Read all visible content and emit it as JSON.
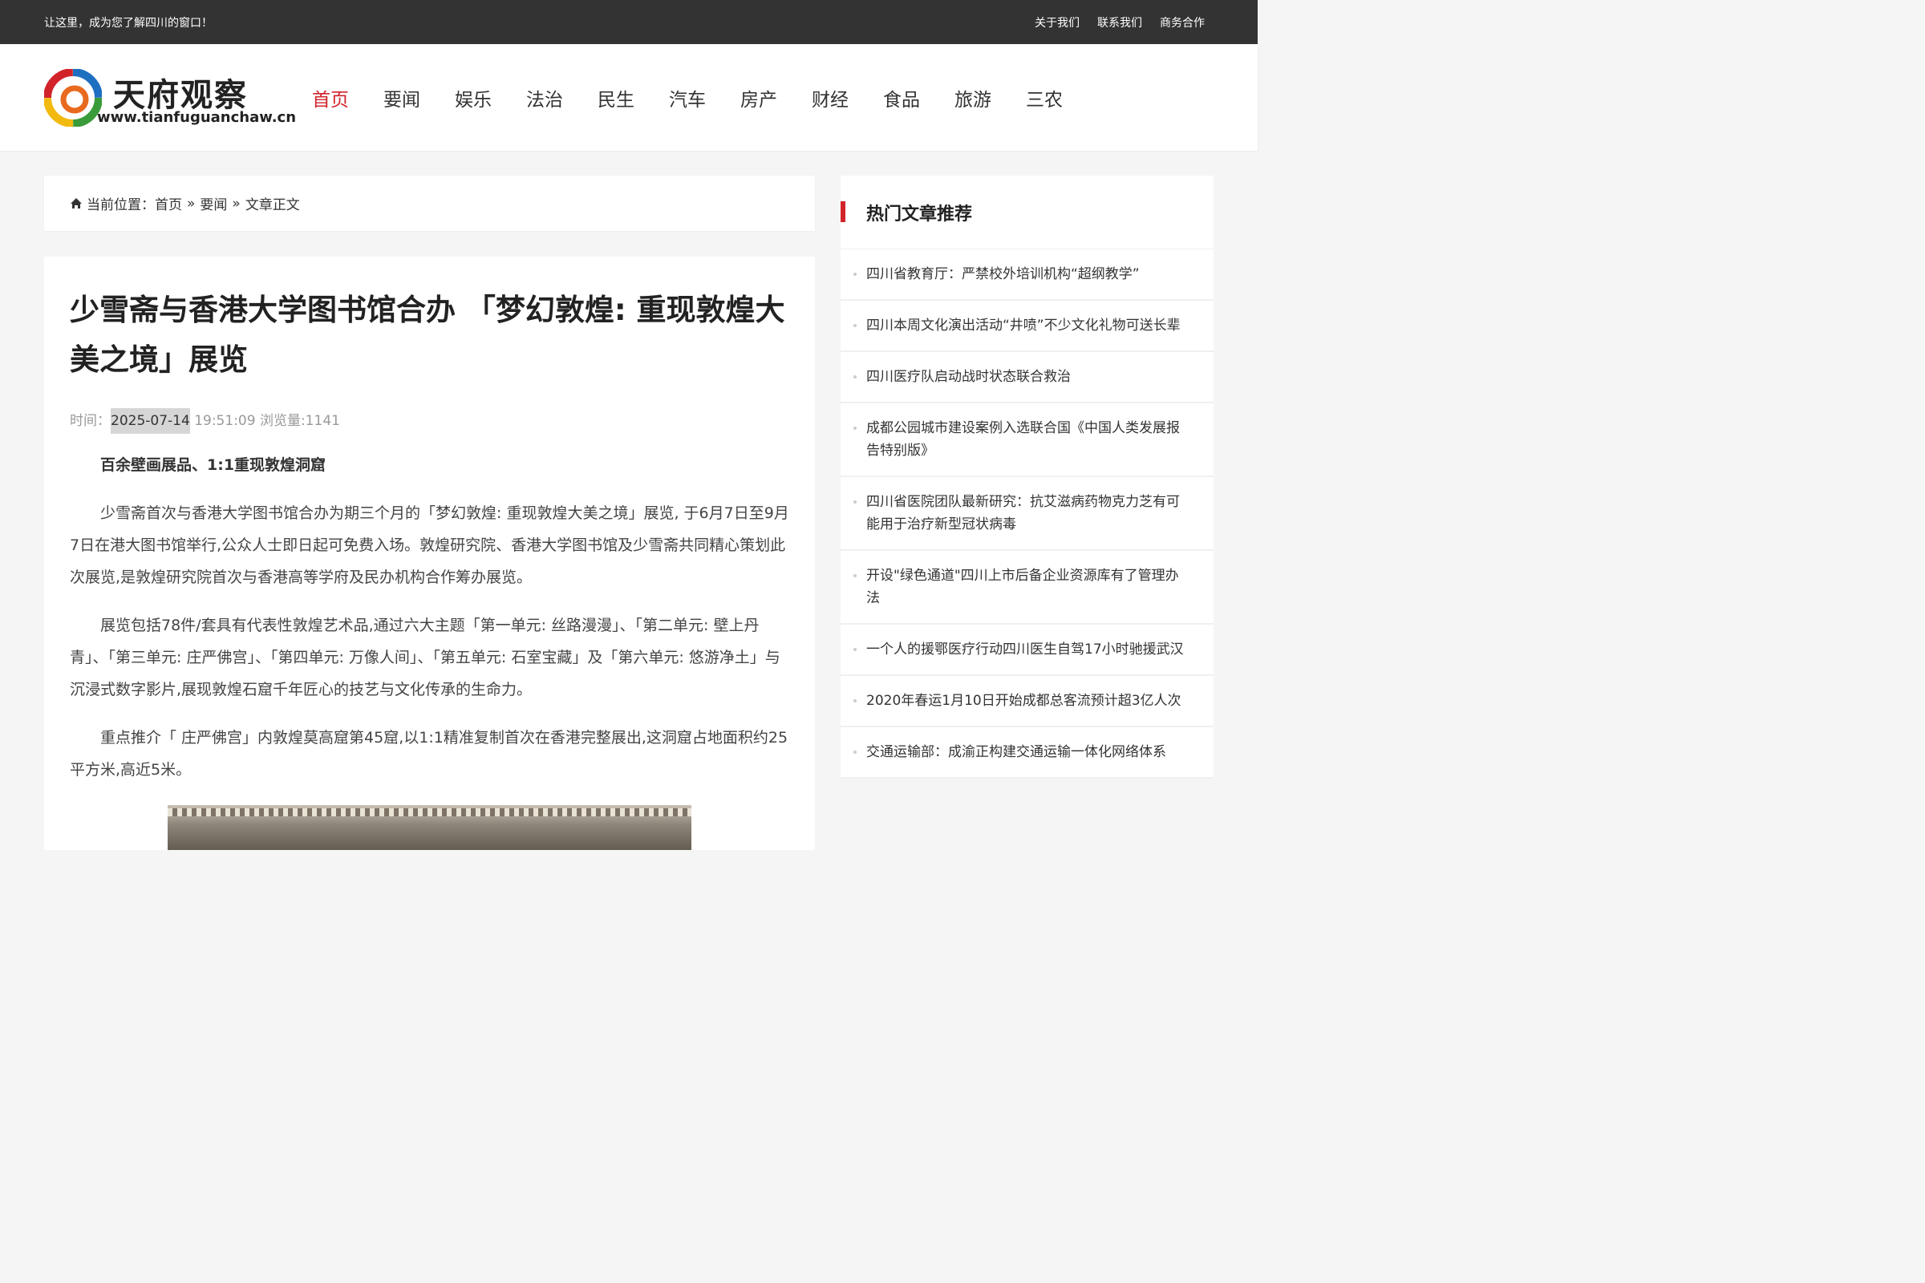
{
  "topbar": {
    "slogan": "让这里，成为您了解四川的窗口！",
    "links": [
      "关于我们",
      "联系我们",
      "商务合作"
    ]
  },
  "logo": {
    "title": "天府观察",
    "url": "www.tianfuguanchaw.cn"
  },
  "nav": {
    "items": [
      "首页",
      "要闻",
      "娱乐",
      "法治",
      "民生",
      "汽车",
      "房产",
      "财经",
      "食品",
      "旅游",
      "三农"
    ],
    "active": "首页"
  },
  "breadcrumb": {
    "prefix": "当前位置：",
    "items": [
      "首页",
      "要闻",
      "文章正文"
    ],
    "separator": "»"
  },
  "article": {
    "title": "少雪斋与香港大学图书馆合办 「梦幻敦煌: 重现敦煌大美之境」展览",
    "meta_prefix": "时间：",
    "date": "2025-07-14",
    "meta_rest": " 19:51:09 浏览量:1141",
    "lead": "百余壁画展品、1:1重现敦煌洞窟",
    "paragraphs": [
      "少雪斋首次与香港大学图书馆合办为期三个月的「梦幻敦煌: 重现敦煌大美之境」展览, 于6月7日至9月7日在港大图书馆举行,公众人士即日起可免费入场。敦煌研究院、香港大学图书馆及少雪斋共同精心策划此次展览,是敦煌研究院首次与香港高等学府及民办机构合作筹办展览。",
      "展览包括78件/套具有代表性敦煌艺术品,通过六大主题「第一单元: 丝路漫漫」、「第二单元: 壁上丹青」、「第三单元: 庄严佛宫」、「第四单元: 万像人间」、「第五单元: 石室宝藏」及「第六单元: 悠游净土」与沉浸式数字影片,展现敦煌石窟千年匠心的技艺与文化传承的生命力。",
      "重点推介「 庄严佛宫」内敦煌莫高窟第45窟,以1:1精准复制首次在香港完整展出,这洞窟占地面积约25平方米,高近5米。"
    ]
  },
  "sidebar": {
    "title": "热门文章推荐",
    "items": [
      "四川省教育厅：严禁校外培训机构“超纲教学”",
      "四川本周文化演出活动“井喷”不少文化礼物可送长辈",
      "四川医疗队启动战时状态联合救治",
      "成都公园城市建设案例入选联合国《中国人类发展报告特别版》",
      "四川省医院团队最新研究：抗艾滋病药物克力芝有可能用于治疗新型冠状病毒",
      "开设\"绿色通道\"四川上市后备企业资源库有了管理办法",
      "一个人的援鄂医疗行动四川医生自驾17小时驰援武汉",
      "2020年春运1月10日开始成都总客流预计超3亿人次",
      "交通运输部：成渝正构建交通运输一体化网络体系"
    ]
  },
  "colors": {
    "accent": "#d2232a",
    "topbar": "#333333"
  }
}
